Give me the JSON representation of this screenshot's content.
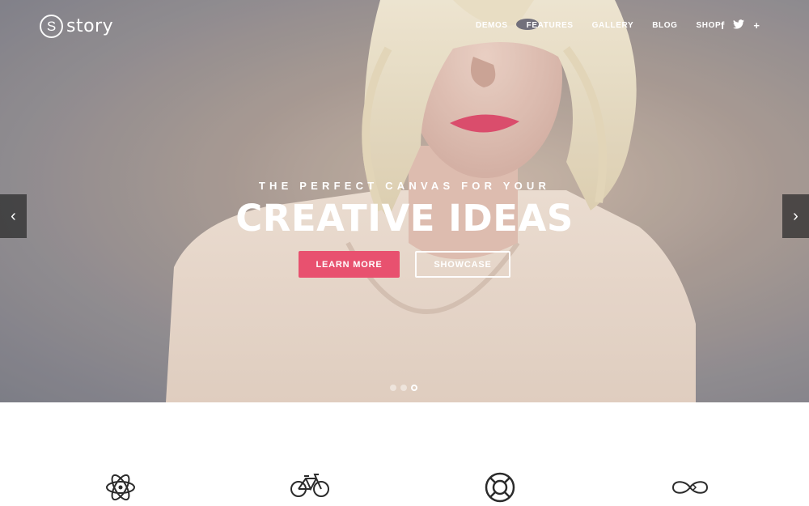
{
  "brand": {
    "logo_letter": "S",
    "name": "story"
  },
  "nav": {
    "items": [
      "DEMOS",
      "FEATURES",
      "GALLERY",
      "BLOG",
      "SHOP"
    ]
  },
  "social": {
    "facebook": "f",
    "twitter": "🐦",
    "plus": "+"
  },
  "hero": {
    "subtitle": "THE PERFECT CANVAS FOR YOUR",
    "headline": "CREATIVE IDEAS",
    "primary_button": "LEARN MORE",
    "secondary_button": "SHOWCASE",
    "prev_arrow": "‹",
    "next_arrow": "›",
    "slide_count": 3,
    "active_slide": 3
  },
  "features": {
    "icons": [
      "atom-icon",
      "bicycle-icon",
      "lifebuoy-icon",
      "infinity-icon"
    ]
  },
  "colors": {
    "accent": "#e8516f",
    "arrow_bg": "#282828",
    "icon_stroke": "#2b2b2b"
  }
}
